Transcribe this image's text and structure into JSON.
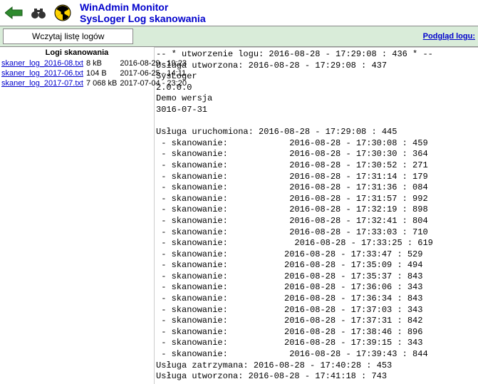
{
  "header": {
    "title": "WinAdmin Monitor",
    "subtitle": "SysLoger Log skanowania"
  },
  "toolbar": {
    "load_label": "Wczytaj listę logów",
    "preview_label": "Podgląd logu:"
  },
  "left": {
    "header": "Logi skanowania",
    "rows": [
      {
        "name": "skaner_log_2016-08.txt",
        "size": "8 kB",
        "date": "2016-08-29 - 19:23"
      },
      {
        "name": "skaner_log_2017-06.txt",
        "size": "104 B",
        "date": "2017-06-25 - 14:11"
      },
      {
        "name": "skaner_log_2017-07.txt",
        "size": "7 068 kB",
        "date": "2017-07-04 - 23:20"
      }
    ]
  },
  "log_text": "-- * utworzenie logu: 2016-08-28 - 17:29:08 : 436 * --\nUsługa utworzona: 2016-08-28 - 17:29:08 : 437\nSysLoger\n2.0.0.0\nDemo wersja\n3016-07-31\n\nUsługa uruchomiona: 2016-08-28 - 17:29:08 : 445\n - skanowanie:            2016-08-28 - 17:30:08 : 459\n - skanowanie:            2016-08-28 - 17:30:30 : 364\n - skanowanie:            2016-08-28 - 17:30:52 : 271\n - skanowanie:            2016-08-28 - 17:31:14 : 179\n - skanowanie:            2016-08-28 - 17:31:36 : 084\n - skanowanie:            2016-08-28 - 17:31:57 : 992\n - skanowanie:            2016-08-28 - 17:32:19 : 898\n - skanowanie:            2016-08-28 - 17:32:41 : 804\n - skanowanie:            2016-08-28 - 17:33:03 : 710\n - skanowanie:             2016-08-28 - 17:33:25 : 619\n - skanowanie:           2016-08-28 - 17:33:47 : 529\n - skanowanie:           2016-08-28 - 17:35:09 : 494\n - skanowanie:           2016-08-28 - 17:35:37 : 843\n - skanowanie:           2016-08-28 - 17:36:06 : 343\n - skanowanie:           2016-08-28 - 17:36:34 : 843\n - skanowanie:           2016-08-28 - 17:37:03 : 343\n - skanowanie:           2016-08-28 - 17:37:31 : 842\n - skanowanie:           2016-08-28 - 17:38:46 : 896\n - skanowanie:           2016-08-28 - 17:39:15 : 343\n - skanowanie:            2016-08-28 - 17:39:43 : 844\nUsługa zatrzymana: 2016-08-28 - 17:40:28 : 453\nUsługa utworzona: 2016-08-28 - 17:41:18 : 743"
}
